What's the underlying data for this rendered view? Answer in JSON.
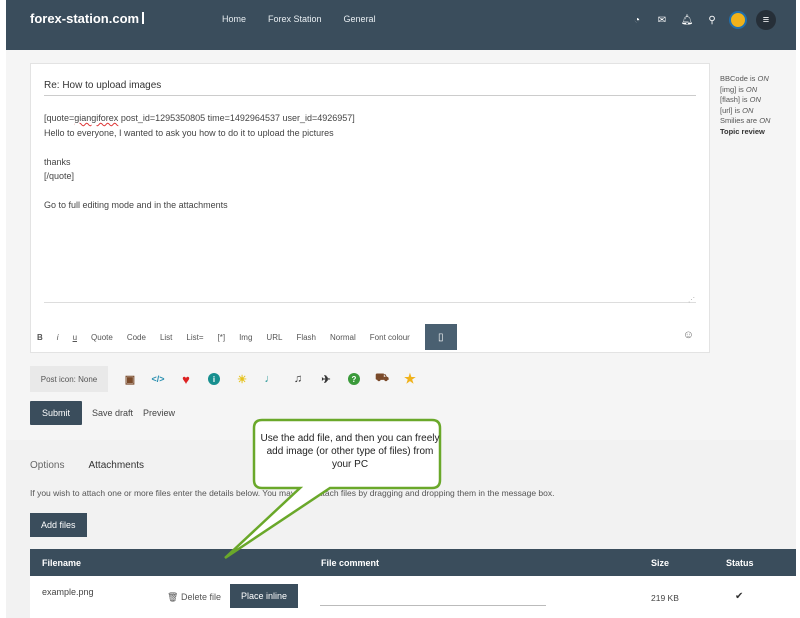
{
  "header": {
    "logo": "forex-station.com",
    "nav": [
      "Home",
      "Forex Station",
      "General"
    ],
    "icons": [
      "dashboard-icon",
      "mail-icon",
      "bell-icon",
      "search-icon",
      "avatar",
      "menu-icon"
    ]
  },
  "editor": {
    "subject": "Re: How to upload images",
    "lines": [
      "[quote=giangiforex post_id=1295350805 time=1492964537 user_id=4926957]",
      "Hello to everyone, I wanted to ask you how to do it to upload the pictures",
      "",
      "thanks",
      "[/quote]",
      "",
      "Go to full editing mode and in the attachments"
    ],
    "line1_prefix": "[quote=",
    "line1_flagged": "giangiforex",
    "line1_suffix": " post_id=1295350805 time=1492964537 user_id=4926957]"
  },
  "toolbar": {
    "bold": "B",
    "italic": "i",
    "underline": "u",
    "quote": "Quote",
    "code": "Code",
    "list": "List",
    "list_eq": "List=",
    "list_item": "[*]",
    "img": "Img",
    "url": "URL",
    "flash": "Flash",
    "size": "Normal",
    "font_colour": "Font colour"
  },
  "post_icons": {
    "label": "Post icon: None",
    "icons": [
      {
        "name": "briefcase-icon",
        "glyph": "▣",
        "color": "#7a4a2a"
      },
      {
        "name": "code-icon",
        "glyph": "</>",
        "color": "#2a8fb0"
      },
      {
        "name": "heart-icon",
        "glyph": "♥",
        "color": "#d22"
      },
      {
        "name": "info-icon",
        "glyph": "i",
        "color": "#178f8f"
      },
      {
        "name": "lightbulb-icon",
        "glyph": "💡",
        "color": "#e6c21a"
      },
      {
        "name": "microphone-icon",
        "glyph": "🎤",
        "color": "#178f8f"
      },
      {
        "name": "music-icon",
        "glyph": "♫",
        "color": "#333"
      },
      {
        "name": "airplane-icon",
        "glyph": "✈",
        "color": "#333"
      },
      {
        "name": "question-icon",
        "glyph": "?",
        "color": "#3a9a3a"
      },
      {
        "name": "cart-icon",
        "glyph": "🛒",
        "color": "#7a4a2a"
      },
      {
        "name": "star-icon",
        "glyph": "★",
        "color": "#f0b21b"
      }
    ]
  },
  "actions": {
    "submit": "Submit",
    "save_draft": "Save draft",
    "preview": "Preview"
  },
  "sidebar": {
    "bbcode_label": "BBCode is",
    "bbcode_value": "ON",
    "img_label": "[img] is",
    "img_value": "ON",
    "flash_label": "[flash] is",
    "flash_value": "ON",
    "url_label": "[url] is",
    "url_value": "ON",
    "smilies_label": "Smilies are",
    "smilies_value": "ON",
    "topic_review": "Topic review"
  },
  "attachments": {
    "tabs": [
      "Options",
      "Attachments"
    ],
    "info": "If you wish to attach one or more files enter the details below. You may also attach files by dragging and dropping them in the message box.",
    "add_files": "Add files",
    "columns": [
      "Filename",
      "File comment",
      "Size",
      "Status"
    ],
    "rows": [
      {
        "filename": "example.png",
        "delete": "Delete file",
        "place": "Place inline",
        "size": "219 KB"
      }
    ]
  },
  "callout": {
    "text": "Use the add file, and then you can freely add image (or other type of files) from your PC"
  }
}
